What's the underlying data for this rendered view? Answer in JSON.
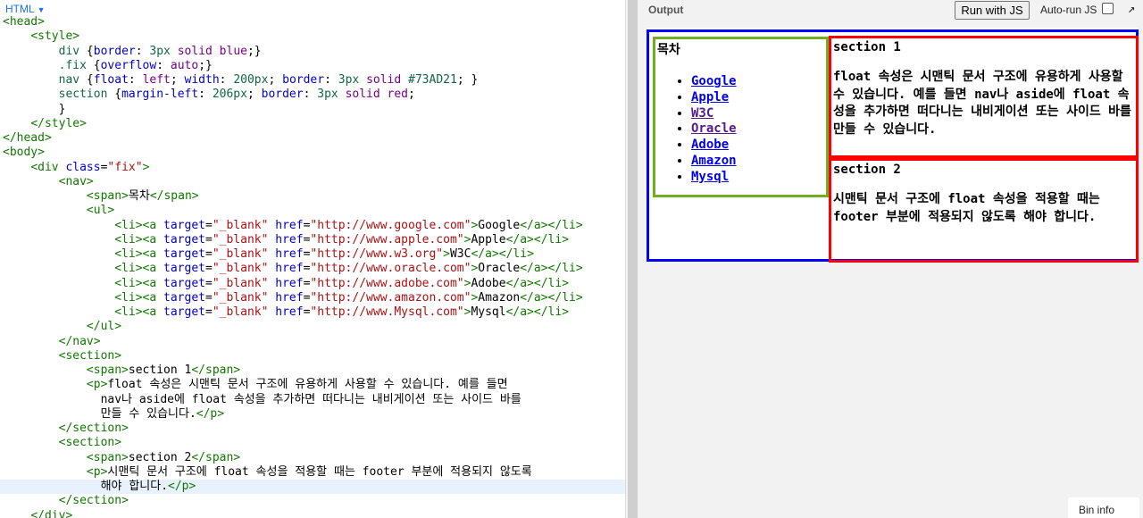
{
  "editor": {
    "language_tab": "HTML",
    "lines": [
      [
        [
          "tg",
          "<head>"
        ]
      ],
      [
        [
          "tx",
          "    "
        ],
        [
          "tg",
          "<style>"
        ]
      ],
      [
        [
          "tx",
          "        "
        ],
        [
          "nm",
          "div"
        ],
        [
          "tx",
          " {"
        ],
        [
          "pr",
          "border"
        ],
        [
          "tx",
          ": "
        ],
        [
          "nm",
          "3px"
        ],
        [
          "tx",
          " "
        ],
        [
          "kw",
          "solid"
        ],
        [
          "tx",
          " "
        ],
        [
          "kw",
          "blue"
        ],
        [
          "tx",
          ";}"
        ]
      ],
      [
        [
          "tx",
          "        "
        ],
        [
          "nm",
          ".fix"
        ],
        [
          "tx",
          " {"
        ],
        [
          "pr",
          "overflow"
        ],
        [
          "tx",
          ": "
        ],
        [
          "kw",
          "auto"
        ],
        [
          "tx",
          ";}"
        ]
      ],
      [
        [
          "tx",
          "        "
        ],
        [
          "nm",
          "nav"
        ],
        [
          "tx",
          " {"
        ],
        [
          "pr",
          "float"
        ],
        [
          "tx",
          ": "
        ],
        [
          "kw",
          "left"
        ],
        [
          "tx",
          "; "
        ],
        [
          "pr",
          "width"
        ],
        [
          "tx",
          ": "
        ],
        [
          "nm",
          "200px"
        ],
        [
          "tx",
          "; "
        ],
        [
          "pr",
          "border"
        ],
        [
          "tx",
          ": "
        ],
        [
          "nm",
          "3px"
        ],
        [
          "tx",
          " "
        ],
        [
          "kw",
          "solid"
        ],
        [
          "tx",
          " "
        ],
        [
          "nm",
          "#73AD21"
        ],
        [
          "tx",
          "; }"
        ]
      ],
      [
        [
          "tx",
          "        "
        ],
        [
          "nm",
          "section"
        ],
        [
          "tx",
          " {"
        ],
        [
          "pr",
          "margin-left"
        ],
        [
          "tx",
          ": "
        ],
        [
          "nm",
          "206px"
        ],
        [
          "tx",
          "; "
        ],
        [
          "pr",
          "border"
        ],
        [
          "tx",
          ": "
        ],
        [
          "nm",
          "3px"
        ],
        [
          "tx",
          " "
        ],
        [
          "kw",
          "solid"
        ],
        [
          "tx",
          " "
        ],
        [
          "kw",
          "red"
        ],
        [
          "tx",
          ";"
        ]
      ],
      [
        [
          "tx",
          "        }"
        ]
      ],
      [
        [
          "tx",
          "    "
        ],
        [
          "tg",
          "</style>"
        ]
      ],
      [
        [
          "tg",
          "</head>"
        ]
      ],
      [
        [
          "tg",
          "<body>"
        ]
      ],
      [
        [
          "tx",
          "    "
        ],
        [
          "tg",
          "<div"
        ],
        [
          "tx",
          " "
        ],
        [
          "at",
          "class"
        ],
        [
          "tx",
          "="
        ],
        [
          "st",
          "\"fix\""
        ],
        [
          "tg",
          ">"
        ]
      ],
      [
        [
          "tx",
          "        "
        ],
        [
          "tg",
          "<nav>"
        ]
      ],
      [
        [
          "tx",
          "            "
        ],
        [
          "tg",
          "<span>"
        ],
        [
          "tx",
          "목차"
        ],
        [
          "tg",
          "</span>"
        ]
      ],
      [
        [
          "tx",
          "            "
        ],
        [
          "tg",
          "<ul>"
        ]
      ],
      [
        [
          "tx",
          "                "
        ],
        [
          "tg",
          "<li><a"
        ],
        [
          "tx",
          " "
        ],
        [
          "at",
          "target"
        ],
        [
          "tx",
          "="
        ],
        [
          "st",
          "\"_blank\""
        ],
        [
          "tx",
          " "
        ],
        [
          "at",
          "href"
        ],
        [
          "tx",
          "="
        ],
        [
          "st",
          "\"http://www.google.com\""
        ],
        [
          "tg",
          ">"
        ],
        [
          "tx",
          "Google"
        ],
        [
          "tg",
          "</a></li>"
        ]
      ],
      [
        [
          "tx",
          "                "
        ],
        [
          "tg",
          "<li><a"
        ],
        [
          "tx",
          " "
        ],
        [
          "at",
          "target"
        ],
        [
          "tx",
          "="
        ],
        [
          "st",
          "\"_blank\""
        ],
        [
          "tx",
          " "
        ],
        [
          "at",
          "href"
        ],
        [
          "tx",
          "="
        ],
        [
          "st",
          "\"http://www.apple.com\""
        ],
        [
          "tg",
          ">"
        ],
        [
          "tx",
          "Apple"
        ],
        [
          "tg",
          "</a></li>"
        ]
      ],
      [
        [
          "tx",
          "                "
        ],
        [
          "tg",
          "<li><a"
        ],
        [
          "tx",
          " "
        ],
        [
          "at",
          "target"
        ],
        [
          "tx",
          "="
        ],
        [
          "st",
          "\"_blank\""
        ],
        [
          "tx",
          " "
        ],
        [
          "at",
          "href"
        ],
        [
          "tx",
          "="
        ],
        [
          "st",
          "\"http://www.w3.org\""
        ],
        [
          "tg",
          ">"
        ],
        [
          "tx",
          "W3C"
        ],
        [
          "tg",
          "</a></li>"
        ]
      ],
      [
        [
          "tx",
          "                "
        ],
        [
          "tg",
          "<li><a"
        ],
        [
          "tx",
          " "
        ],
        [
          "at",
          "target"
        ],
        [
          "tx",
          "="
        ],
        [
          "st",
          "\"_blank\""
        ],
        [
          "tx",
          " "
        ],
        [
          "at",
          "href"
        ],
        [
          "tx",
          "="
        ],
        [
          "st",
          "\"http://www.oracle.com\""
        ],
        [
          "tg",
          ">"
        ],
        [
          "tx",
          "Oracle"
        ],
        [
          "tg",
          "</a></li>"
        ]
      ],
      [
        [
          "tx",
          "                "
        ],
        [
          "tg",
          "<li><a"
        ],
        [
          "tx",
          " "
        ],
        [
          "at",
          "target"
        ],
        [
          "tx",
          "="
        ],
        [
          "st",
          "\"_blank\""
        ],
        [
          "tx",
          " "
        ],
        [
          "at",
          "href"
        ],
        [
          "tx",
          "="
        ],
        [
          "st",
          "\"http://www.adobe.com\""
        ],
        [
          "tg",
          ">"
        ],
        [
          "tx",
          "Adobe"
        ],
        [
          "tg",
          "</a></li>"
        ]
      ],
      [
        [
          "tx",
          "                "
        ],
        [
          "tg",
          "<li><a"
        ],
        [
          "tx",
          " "
        ],
        [
          "at",
          "target"
        ],
        [
          "tx",
          "="
        ],
        [
          "st",
          "\"_blank\""
        ],
        [
          "tx",
          " "
        ],
        [
          "at",
          "href"
        ],
        [
          "tx",
          "="
        ],
        [
          "st",
          "\"http://www.amazon.com\""
        ],
        [
          "tg",
          ">"
        ],
        [
          "tx",
          "Amazon"
        ],
        [
          "tg",
          "</a></li>"
        ]
      ],
      [
        [
          "tx",
          "                "
        ],
        [
          "tg",
          "<li><a"
        ],
        [
          "tx",
          " "
        ],
        [
          "at",
          "target"
        ],
        [
          "tx",
          "="
        ],
        [
          "st",
          "\"_blank\""
        ],
        [
          "tx",
          " "
        ],
        [
          "at",
          "href"
        ],
        [
          "tx",
          "="
        ],
        [
          "st",
          "\"http://www.Mysql.com\""
        ],
        [
          "tg",
          ">"
        ],
        [
          "tx",
          "Mysql"
        ],
        [
          "tg",
          "</a></li>"
        ]
      ],
      [
        [
          "tx",
          "            "
        ],
        [
          "tg",
          "</ul>"
        ]
      ],
      [
        [
          "tx",
          "        "
        ],
        [
          "tg",
          "</nav>"
        ]
      ],
      [
        [
          "tx",
          "        "
        ],
        [
          "tg",
          "<section>"
        ]
      ],
      [
        [
          "tx",
          "            "
        ],
        [
          "tg",
          "<span>"
        ],
        [
          "tx",
          "section 1"
        ],
        [
          "tg",
          "</span>"
        ]
      ],
      [
        [
          "tx",
          "            "
        ],
        [
          "tg",
          "<p>"
        ],
        [
          "tx",
          "float 속성은 시맨틱 문서 구조에 유용하게 사용할 수 있습니다. 예를 들면"
        ]
      ],
      [
        [
          "tx",
          "              nav나 aside에 float 속성을 추가하면 떠다니는 내비게이션 또는 사이드 바를"
        ]
      ],
      [
        [
          "tx",
          "              만들 수 있습니다."
        ],
        [
          "tg",
          "</p>"
        ]
      ],
      [
        [
          "tx",
          "        "
        ],
        [
          "tg",
          "</section>"
        ]
      ],
      [
        [
          "tx",
          "        "
        ],
        [
          "tg",
          "<section>"
        ]
      ],
      [
        [
          "tx",
          "            "
        ],
        [
          "tg",
          "<span>"
        ],
        [
          "tx",
          "section 2"
        ],
        [
          "tg",
          "</span>"
        ]
      ],
      [
        [
          "tx",
          "            "
        ],
        [
          "tg",
          "<p>"
        ],
        [
          "tx",
          "시맨틱 문서 구조에 float 속성을 적용할 때는 footer 부분에 적용되지 않도록"
        ]
      ],
      [
        [
          "tx",
          "              해야 합니다."
        ],
        [
          "tg",
          "</p>"
        ]
      ],
      [
        [
          "tx",
          "        "
        ],
        [
          "tg",
          "</section>"
        ]
      ],
      [
        [
          "tx",
          "    "
        ],
        [
          "tg",
          "</div>"
        ]
      ]
    ],
    "active_line": 32
  },
  "output": {
    "title": "Output",
    "run_button": "Run with JS",
    "autorun_label": "Auto-run JS",
    "autorun_checked": false,
    "info_tab": "Bin info"
  },
  "preview": {
    "nav_title": "목차",
    "links": [
      {
        "label": "Google",
        "visited": false
      },
      {
        "label": "Apple",
        "visited": false
      },
      {
        "label": "W3C",
        "visited": true
      },
      {
        "label": "Oracle",
        "visited": true
      },
      {
        "label": "Adobe",
        "visited": false
      },
      {
        "label": "Amazon",
        "visited": false
      },
      {
        "label": "Mysql",
        "visited": false
      }
    ],
    "sections": [
      {
        "title": "section 1",
        "text": "float 속성은 시맨틱 문서 구조에 유용하게 사용할 수 있습니다. 예를 들면 nav나 aside에 float 속성을 추가하면 떠다니는 내비게이션 또는 사이드 바를 만들 수 있습니다."
      },
      {
        "title": "section 2",
        "text": "시맨틱 문서 구조에 float 속성을 적용할 때는 footer 부분에 적용되지 않도록 해야 합니다."
      }
    ],
    "colors": {
      "outer_border": "#0000ff",
      "nav_border": "#73AD21",
      "section_border": "#ff0000",
      "link": "#0000ee",
      "visited_link": "#551a8b"
    }
  }
}
